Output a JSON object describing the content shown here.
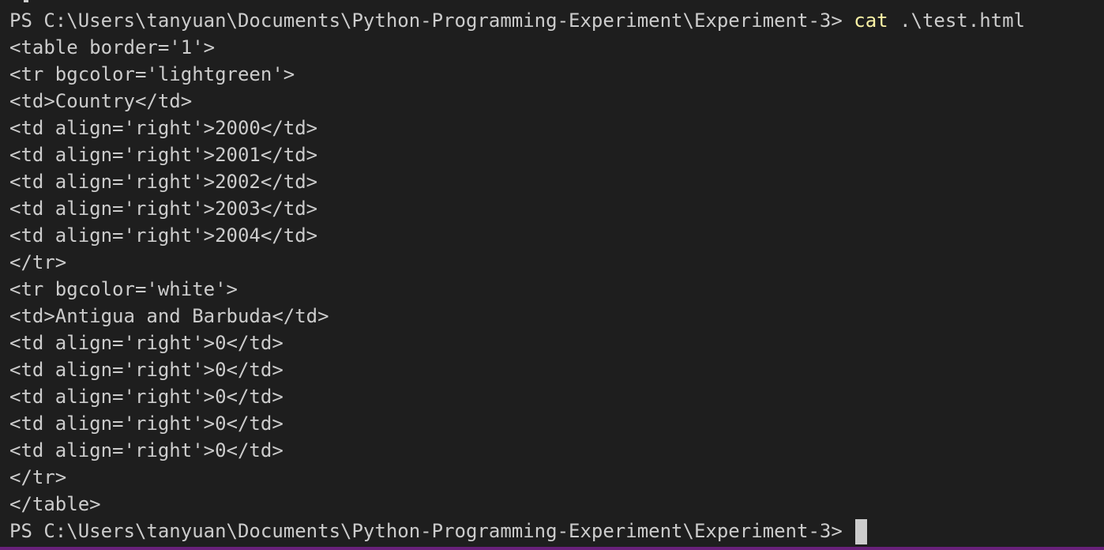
{
  "terminal": {
    "prompt_path": "PS C:\\Users\\tanyuan\\Documents\\Python-Programming-Experiment\\Experiment-3>",
    "command": "cat",
    "command_arg": ".\\test.html",
    "output_lines": [
      "<table border='1'>",
      "<tr bgcolor='lightgreen'>",
      "<td>Country</td>",
      "<td align='right'>2000</td>",
      "<td align='right'>2001</td>",
      "<td align='right'>2002</td>",
      "<td align='right'>2003</td>",
      "<td align='right'>2004</td>",
      "</tr>",
      "<tr bgcolor='white'>",
      "<td>Antigua and Barbuda</td>",
      "<td align='right'>0</td>",
      "<td align='right'>0</td>",
      "<td align='right'>0</td>",
      "<td align='right'>0</td>",
      "<td align='right'>0</td>",
      "</tr>",
      "</table>"
    ],
    "final_prompt": "PS C:\\Users\\tanyuan\\Documents\\Python-Programming-Experiment\\Experiment-3>"
  },
  "colors": {
    "background": "#1e1e1e",
    "foreground": "#cccccc",
    "command": "#f9f1a5",
    "status_bar": "#68217a"
  }
}
